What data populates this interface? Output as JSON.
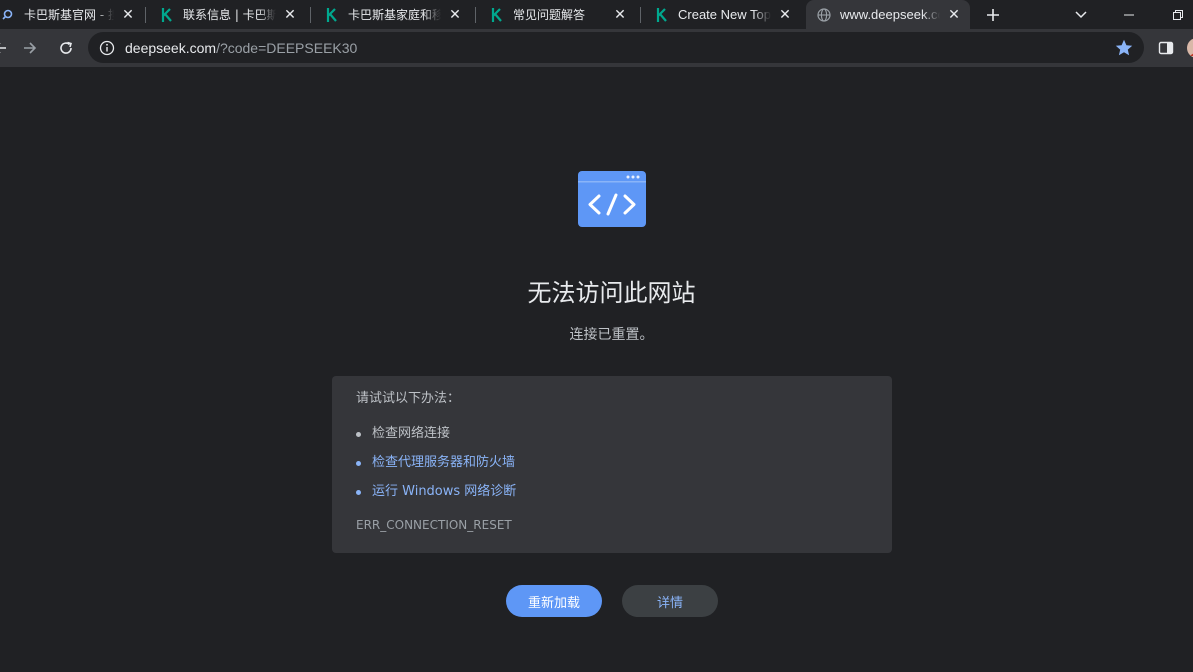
{
  "tabs": [
    {
      "title": "卡巴斯基官网 - 搜索",
      "icon": "search-icon",
      "active": false
    },
    {
      "title": "联系信息 | 卡巴斯基",
      "icon": "kaspersky-logo-icon",
      "active": false
    },
    {
      "title": "卡巴斯基家庭和移动",
      "icon": "kaspersky-logo-icon",
      "active": false
    },
    {
      "title": "常见问题解答",
      "icon": "kaspersky-logo-icon",
      "active": false
    },
    {
      "title": "Create New Topic",
      "icon": "kaspersky-logo-icon",
      "active": false
    },
    {
      "title": "www.deepseek.com",
      "icon": "globe-icon",
      "active": true
    }
  ],
  "toolbar": {
    "url_host": "deepseek.com",
    "url_path": "/?code=DEEPSEEK30"
  },
  "error_page": {
    "headline": "无法访问此网站",
    "subline": "连接已重置。",
    "suggestions_intro": "请试试以下办法：",
    "suggestions": [
      {
        "text": "检查网络连接",
        "link": false
      },
      {
        "text": "检查代理服务器和防火墙",
        "link": true
      },
      {
        "text": "运行 Windows 网络诊断",
        "link": true
      }
    ],
    "error_code": "ERR_CONNECTION_RESET",
    "reload_label": "重新加载",
    "details_label": "详情"
  },
  "colors": {
    "accent": "#8ab4f8",
    "primary_button": "#5e97f6",
    "kaspersky_green": "#00a88e",
    "background": "#202124",
    "toolbar": "#35363a"
  }
}
